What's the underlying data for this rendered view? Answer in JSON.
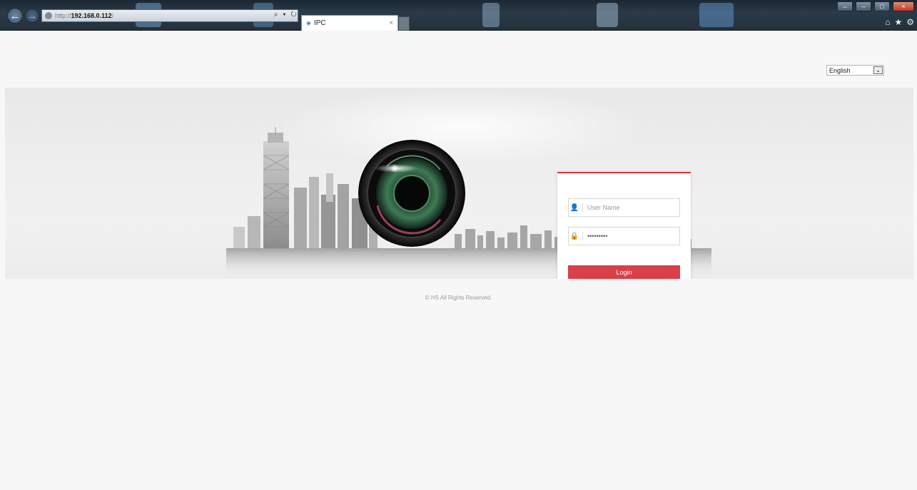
{
  "browser": {
    "address": {
      "protocol": "http://",
      "host": "192.168.0.112",
      "path": "/"
    },
    "address_tools": "⌕ ▾ ↻",
    "tab": {
      "title": "IPC",
      "close": "×"
    },
    "icons": [
      "back-arrow-icon",
      "forward-arrow-icon",
      "home-icon",
      "star-icon",
      "gear-icon"
    ],
    "window_controls": {
      "minimize": "–",
      "maximize": "□",
      "close": "×"
    }
  },
  "language": {
    "selected": "English",
    "chevron": "⌄"
  },
  "login": {
    "username_placeholder": "User Name",
    "password_value": "•••••••••",
    "button_label": "Login",
    "accent_color": "#d9404a"
  },
  "footer": {
    "text": "©  HS  All Rights Reserved."
  }
}
